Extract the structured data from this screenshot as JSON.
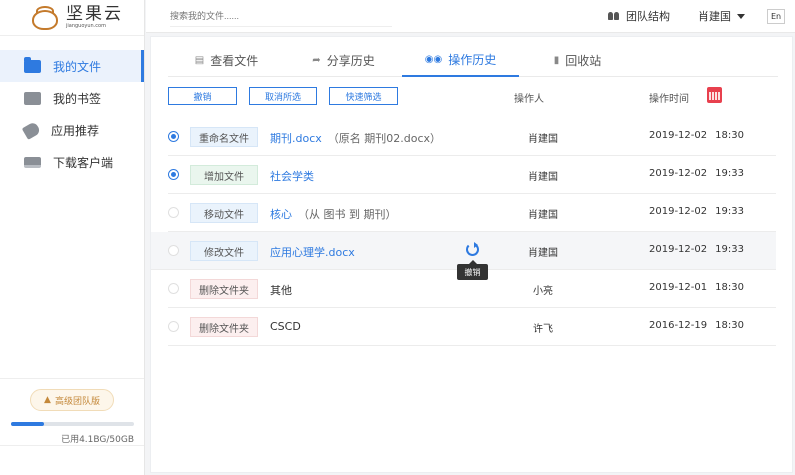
{
  "app": {
    "brand_cn": "坚果云",
    "brand_en": "jianguoyun.com"
  },
  "sidebar": {
    "items": [
      {
        "label": "我的文件",
        "icon": "folder-icon",
        "active": true
      },
      {
        "label": "我的书签",
        "icon": "bookmark-icon",
        "active": false
      },
      {
        "label": "应用推荐",
        "icon": "tag-icon",
        "active": false
      },
      {
        "label": "下载客户端",
        "icon": "computer-icon",
        "active": false
      }
    ],
    "team_badge": "高级团队版",
    "quota_text": "已用4.1BG/50GB",
    "quota_fraction": 0.27
  },
  "topbar": {
    "search_placeholder": "搜索我的文件......",
    "team_link": "团队结构",
    "user_name": "肖建国",
    "lang": "En"
  },
  "tabs": [
    {
      "label": "查看文件",
      "icon": "file-icon",
      "active": false
    },
    {
      "label": "分享历史",
      "icon": "share-icon",
      "active": false
    },
    {
      "label": "操作历史",
      "icon": "history-icon",
      "active": true
    },
    {
      "label": "回收站",
      "icon": "trash-icon",
      "active": false
    }
  ],
  "toolbar": {
    "undo": "撤销",
    "deselect": "取消所选",
    "quick_filter": "快速筛选"
  },
  "columns": {
    "operator": "操作人",
    "time": "操作时间"
  },
  "rows": [
    {
      "type": "重命名文件",
      "color": "blue",
      "name": "期刊.docx",
      "note": "（原名 期刊02.docx）",
      "link": true,
      "operator": "肖建国",
      "date": "2019-12-02",
      "time": "18:30",
      "selected": true
    },
    {
      "type": "增加文件",
      "color": "green",
      "name": "社会学类",
      "note": "",
      "link": true,
      "operator": "肖建国",
      "date": "2019-12-02",
      "time": "19:33",
      "selected": true
    },
    {
      "type": "移动文件",
      "color": "blue",
      "name": "核心",
      "note": "（从 图书 到 期刊）",
      "link": true,
      "operator": "肖建国",
      "date": "2019-12-02",
      "time": "19:33",
      "selected": false
    },
    {
      "type": "修改文件",
      "color": "blue",
      "name": "应用心理学.docx",
      "note": "",
      "link": true,
      "operator": "肖建国",
      "date": "2019-12-02",
      "time": "19:33",
      "selected": false,
      "hover": true
    },
    {
      "type": "删除文件夹",
      "color": "red",
      "name": "其他",
      "note": "",
      "link": false,
      "operator": "小亮",
      "date": "2019-12-01",
      "time": "18:30",
      "selected": false
    },
    {
      "type": "删除文件夹",
      "color": "red",
      "name": "CSCD",
      "note": "",
      "link": false,
      "operator": "许飞",
      "date": "2016-12-19",
      "time": "18:30",
      "selected": false
    }
  ],
  "tooltip": "撤销"
}
